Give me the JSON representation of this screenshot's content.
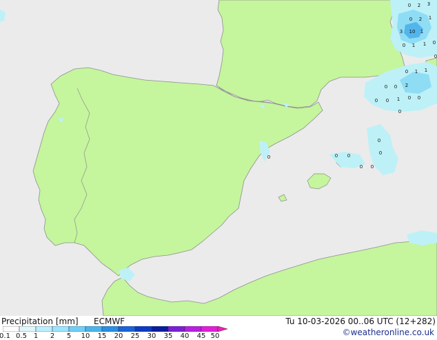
{
  "map": {
    "colors": {
      "sea": "#ebebeb",
      "land": "#c5f59d",
      "coast": "#8e8e8e",
      "precip_light": "#bdf1f7",
      "precip_mid": "#8fdcf5",
      "precip_heavy": "#52b6ec"
    },
    "precip_labels": [
      "0",
      "2",
      "3",
      "0",
      "2",
      "1",
      "3",
      "10",
      "1",
      "0",
      "1",
      "1",
      "0",
      "0",
      "0",
      "1",
      "1",
      "2",
      "0",
      "0",
      "1",
      "0",
      "0",
      "0",
      "0",
      "0",
      "0",
      "0",
      "0",
      "0",
      "0",
      "0",
      "0"
    ]
  },
  "legend": {
    "title": "Precipitation [mm]",
    "model": "ECMWF",
    "datetime": "Tu 10-03-2026 00..06 UTC (12+282)",
    "credit": "©weatheronline.co.uk",
    "scale_labels": [
      "0.1",
      "0.5",
      "1",
      "2",
      "5",
      "10",
      "15",
      "20",
      "25",
      "30",
      "35",
      "40",
      "45",
      "50"
    ],
    "scale_colors": [
      "#ffffff",
      "#e0f7fa",
      "#bcefff",
      "#9be6ff",
      "#6fcff6",
      "#4ab5ec",
      "#2a8fe2",
      "#1a63d8",
      "#0d3bc4",
      "#0a1e9c",
      "#7b20d6",
      "#b91fe0",
      "#e11fd9",
      "#f21fb8"
    ]
  }
}
